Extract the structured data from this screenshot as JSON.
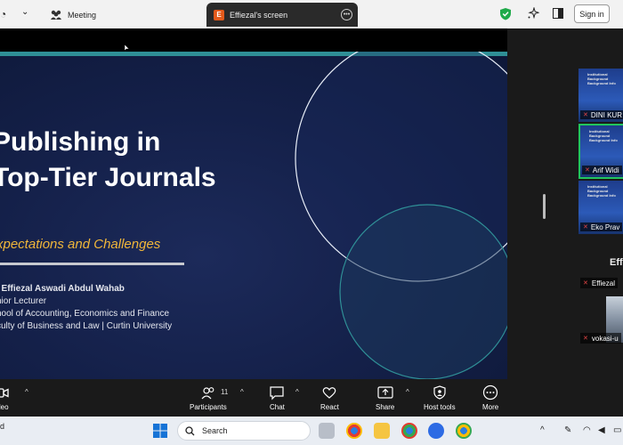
{
  "tabs": {
    "meeting": "Meeting",
    "screen": "Effiezal's screen",
    "screen_icon_letter": "E"
  },
  "signin": "Sign in",
  "slide": {
    "title_line1": "Publishing in",
    "title_line2": "Top-Tier Journals",
    "subtitle": "xpectations and Challenges",
    "author_name": ". Effiezal Aswadi Abdul Wahab",
    "author_role": "nior Lecturer",
    "author_school": "hool of Accounting, Economics and Finance",
    "author_faculty": "culty of Business and Law  |  Curtin University"
  },
  "participants_panel": {
    "thumbs": [
      {
        "label": "DINI KUR"
      },
      {
        "label": "Arif Widi"
      },
      {
        "label": "Eko Prav"
      }
    ],
    "speaker_header": "Eff",
    "rows": [
      {
        "label": "Effiezal"
      },
      {
        "label": "vokasi-u"
      }
    ]
  },
  "toolbar": {
    "video": "ideo",
    "participants": "Participants",
    "participants_count": "11",
    "chat": "Chat",
    "react": "React",
    "share": "Share",
    "host_tools": "Host tools",
    "more": "More"
  },
  "taskbar": {
    "left_fragment": "d",
    "search": "Search"
  },
  "colors": {
    "accent_teal": "#2f8f96",
    "subtitle_gold": "#f0b63a",
    "active_green": "#22c55e",
    "slide_bg": "#142049"
  }
}
